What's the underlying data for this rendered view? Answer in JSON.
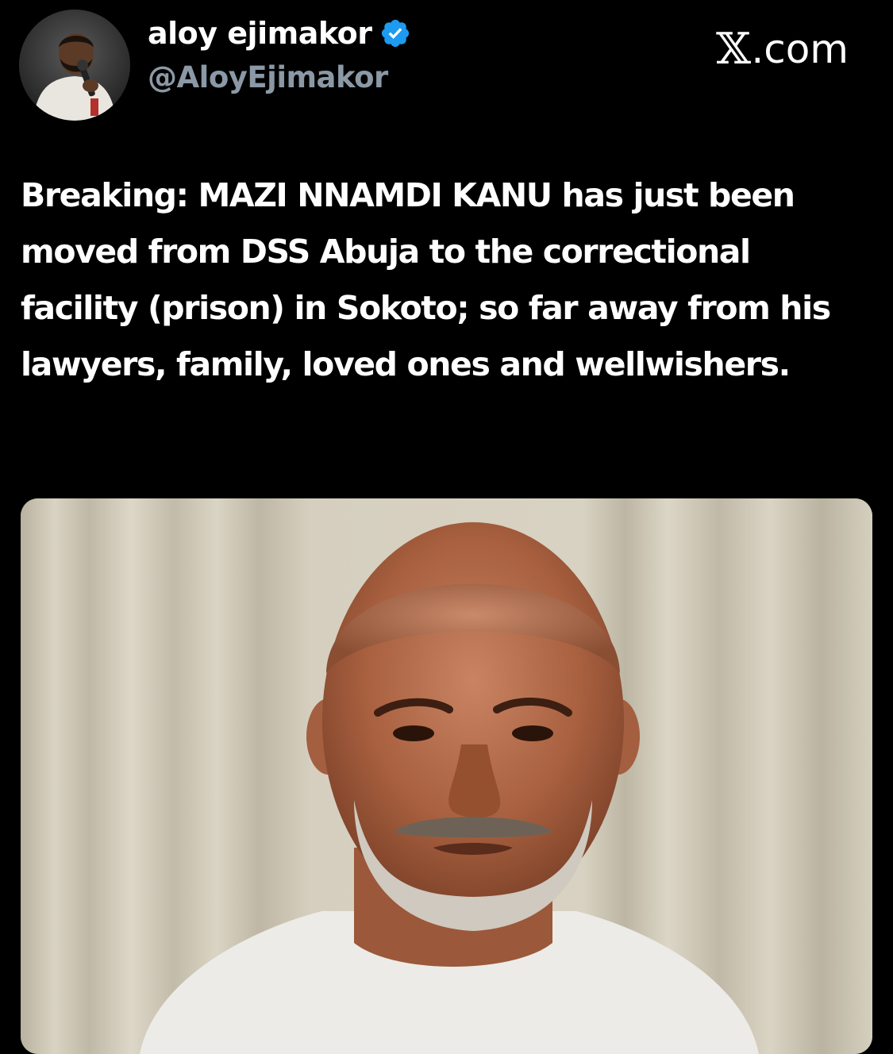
{
  "tweet": {
    "author": {
      "display_name": "aloy ejimakor",
      "handle": "@AloyEjimakor",
      "verified": true,
      "verified_icon": "verified-badge-icon",
      "verified_color": "#1d9bf0"
    },
    "brand": {
      "mark": "𝕏",
      "suffix": ".com"
    },
    "text": "Breaking: MAZI NNAMDI KANU has just been moved from DSS Abuja to the correctional facility (prison) in Sokoto; so far away from his lawyers, family, loved ones and wellwishers."
  },
  "colors": {
    "background": "#000000",
    "text": "#ffffff",
    "handle": "#8b98a5"
  }
}
